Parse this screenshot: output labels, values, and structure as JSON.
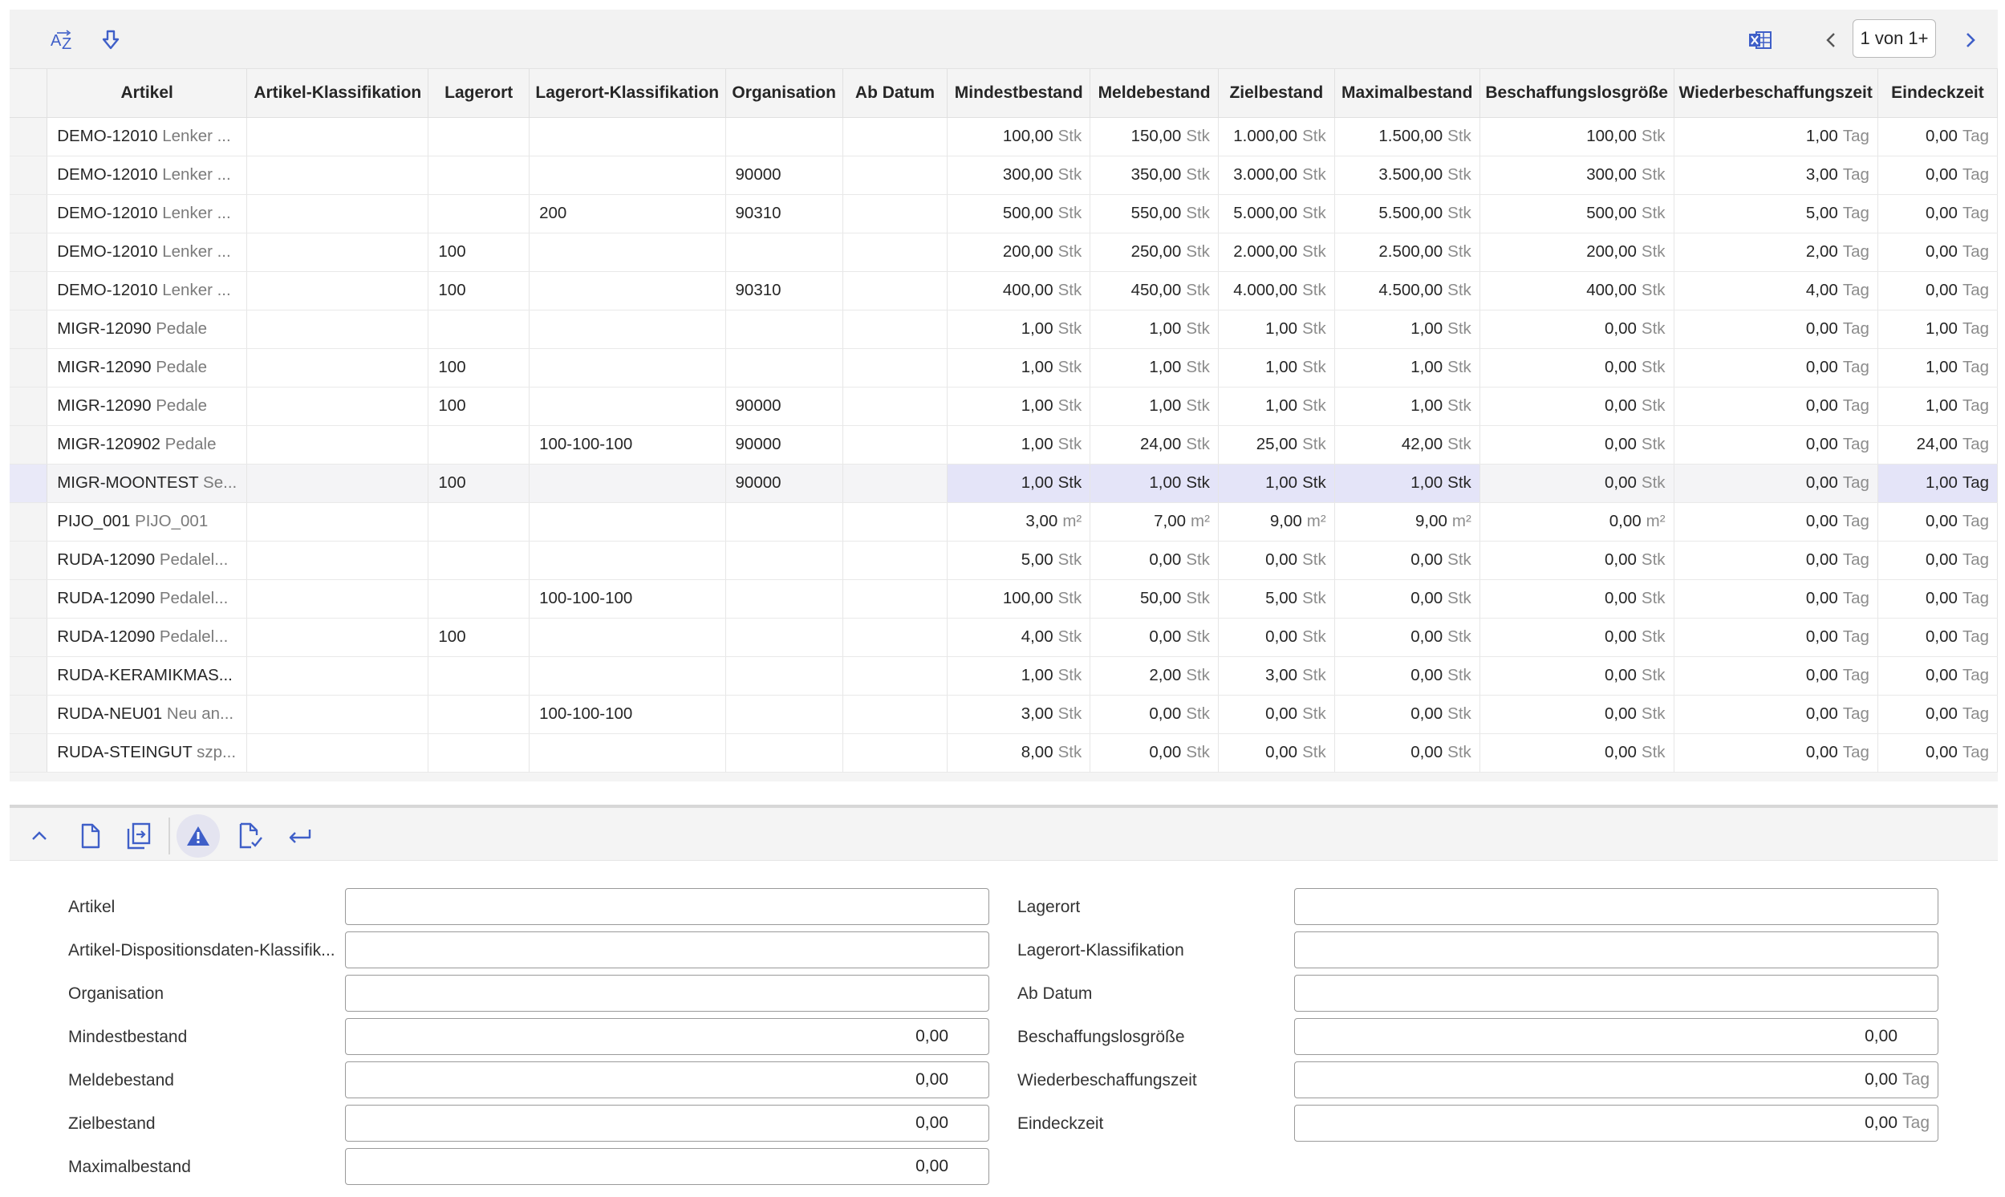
{
  "toolbar": {
    "sort_icon": "sort-az-icon",
    "download_icon": "arrow-down-icon",
    "excel_icon": "excel-icon",
    "pager_text": "1 von 1+"
  },
  "columns": [
    "Artikel",
    "Artikel-Klassifikation",
    "Lagerort",
    "Lagerort-Klassifikation",
    "Organisation",
    "Ab Datum",
    "Mindestbestand",
    "Meldebestand",
    "Zielbestand",
    "Maximalbestand",
    "Beschaffungslosgröße",
    "Wiederbeschaffungszeit",
    "Eindeckzeit"
  ],
  "rows": [
    {
      "code": "DEMO-12010",
      "desc": "Lenker ...",
      "lagerort": "",
      "lagerortkl": "",
      "org": "",
      "abdatum": "",
      "min": "100,00",
      "minu": "Stk",
      "meld": "150,00",
      "meldu": "Stk",
      "ziel": "1.000,00",
      "zielu": "Stk",
      "max": "1.500,00",
      "maxu": "Stk",
      "losg": "100,00",
      "losgu": "Stk",
      "wbz": "1,00",
      "wbzu": "Tag",
      "eind": "0,00",
      "eindu": "Tag"
    },
    {
      "code": "DEMO-12010",
      "desc": "Lenker ...",
      "lagerort": "",
      "lagerortkl": "",
      "org": "90000",
      "abdatum": "",
      "min": "300,00",
      "minu": "Stk",
      "meld": "350,00",
      "meldu": "Stk",
      "ziel": "3.000,00",
      "zielu": "Stk",
      "max": "3.500,00",
      "maxu": "Stk",
      "losg": "300,00",
      "losgu": "Stk",
      "wbz": "3,00",
      "wbzu": "Tag",
      "eind": "0,00",
      "eindu": "Tag"
    },
    {
      "code": "DEMO-12010",
      "desc": "Lenker ...",
      "lagerort": "",
      "lagerortkl": "200",
      "org": "90310",
      "abdatum": "",
      "min": "500,00",
      "minu": "Stk",
      "meld": "550,00",
      "meldu": "Stk",
      "ziel": "5.000,00",
      "zielu": "Stk",
      "max": "5.500,00",
      "maxu": "Stk",
      "losg": "500,00",
      "losgu": "Stk",
      "wbz": "5,00",
      "wbzu": "Tag",
      "eind": "0,00",
      "eindu": "Tag"
    },
    {
      "code": "DEMO-12010",
      "desc": "Lenker ...",
      "lagerort": "100",
      "lagerortkl": "",
      "org": "",
      "abdatum": "",
      "min": "200,00",
      "minu": "Stk",
      "meld": "250,00",
      "meldu": "Stk",
      "ziel": "2.000,00",
      "zielu": "Stk",
      "max": "2.500,00",
      "maxu": "Stk",
      "losg": "200,00",
      "losgu": "Stk",
      "wbz": "2,00",
      "wbzu": "Tag",
      "eind": "0,00",
      "eindu": "Tag"
    },
    {
      "code": "DEMO-12010",
      "desc": "Lenker ...",
      "lagerort": "100",
      "lagerortkl": "",
      "org": "90310",
      "abdatum": "",
      "min": "400,00",
      "minu": "Stk",
      "meld": "450,00",
      "meldu": "Stk",
      "ziel": "4.000,00",
      "zielu": "Stk",
      "max": "4.500,00",
      "maxu": "Stk",
      "losg": "400,00",
      "losgu": "Stk",
      "wbz": "4,00",
      "wbzu": "Tag",
      "eind": "0,00",
      "eindu": "Tag"
    },
    {
      "code": "MIGR-12090",
      "desc": "Pedale",
      "lagerort": "",
      "lagerortkl": "",
      "org": "",
      "abdatum": "",
      "min": "1,00",
      "minu": "Stk",
      "meld": "1,00",
      "meldu": "Stk",
      "ziel": "1,00",
      "zielu": "Stk",
      "max": "1,00",
      "maxu": "Stk",
      "losg": "0,00",
      "losgu": "Stk",
      "wbz": "0,00",
      "wbzu": "Tag",
      "eind": "1,00",
      "eindu": "Tag"
    },
    {
      "code": "MIGR-12090",
      "desc": "Pedale",
      "lagerort": "100",
      "lagerortkl": "",
      "org": "",
      "abdatum": "",
      "min": "1,00",
      "minu": "Stk",
      "meld": "1,00",
      "meldu": "Stk",
      "ziel": "1,00",
      "zielu": "Stk",
      "max": "1,00",
      "maxu": "Stk",
      "losg": "0,00",
      "losgu": "Stk",
      "wbz": "0,00",
      "wbzu": "Tag",
      "eind": "1,00",
      "eindu": "Tag"
    },
    {
      "code": "MIGR-12090",
      "desc": "Pedale",
      "lagerort": "100",
      "lagerortkl": "",
      "org": "90000",
      "abdatum": "",
      "min": "1,00",
      "minu": "Stk",
      "meld": "1,00",
      "meldu": "Stk",
      "ziel": "1,00",
      "zielu": "Stk",
      "max": "1,00",
      "maxu": "Stk",
      "losg": "0,00",
      "losgu": "Stk",
      "wbz": "0,00",
      "wbzu": "Tag",
      "eind": "1,00",
      "eindu": "Tag"
    },
    {
      "code": "MIGR-120902",
      "desc": "Pedale",
      "lagerort": "",
      "lagerortkl": "100-100-100",
      "org": "90000",
      "abdatum": "",
      "min": "1,00",
      "minu": "Stk",
      "meld": "24,00",
      "meldu": "Stk",
      "ziel": "25,00",
      "zielu": "Stk",
      "max": "42,00",
      "maxu": "Stk",
      "losg": "0,00",
      "losgu": "Stk",
      "wbz": "0,00",
      "wbzu": "Tag",
      "eind": "24,00",
      "eindu": "Tag"
    },
    {
      "code": "MIGR-MOONTEST",
      "desc": "Se...",
      "lagerort": "100",
      "lagerortkl": "",
      "org": "90000",
      "abdatum": "",
      "min": "1,00",
      "minu": "Stk",
      "meld": "1,00",
      "meldu": "Stk",
      "ziel": "1,00",
      "zielu": "Stk",
      "max": "1,00",
      "maxu": "Stk",
      "losg": "0,00",
      "losgu": "Stk",
      "wbz": "0,00",
      "wbzu": "Tag",
      "eind": "1,00",
      "eindu": "Tag",
      "active": true
    },
    {
      "code": "PIJO_001",
      "desc": "PIJO_001",
      "lagerort": "",
      "lagerortkl": "",
      "org": "",
      "abdatum": "",
      "min": "3,00",
      "minu": "m²",
      "meld": "7,00",
      "meldu": "m²",
      "ziel": "9,00",
      "zielu": "m²",
      "max": "9,00",
      "maxu": "m²",
      "losg": "0,00",
      "losgu": "m²",
      "wbz": "0,00",
      "wbzu": "Tag",
      "eind": "0,00",
      "eindu": "Tag"
    },
    {
      "code": "RUDA-12090",
      "desc": "Pedalel...",
      "lagerort": "",
      "lagerortkl": "",
      "org": "",
      "abdatum": "",
      "min": "5,00",
      "minu": "Stk",
      "meld": "0,00",
      "meldu": "Stk",
      "ziel": "0,00",
      "zielu": "Stk",
      "max": "0,00",
      "maxu": "Stk",
      "losg": "0,00",
      "losgu": "Stk",
      "wbz": "0,00",
      "wbzu": "Tag",
      "eind": "0,00",
      "eindu": "Tag"
    },
    {
      "code": "RUDA-12090",
      "desc": "Pedalel...",
      "lagerort": "",
      "lagerortkl": "100-100-100",
      "org": "",
      "abdatum": "",
      "min": "100,00",
      "minu": "Stk",
      "meld": "50,00",
      "meldu": "Stk",
      "ziel": "5,00",
      "zielu": "Stk",
      "max": "0,00",
      "maxu": "Stk",
      "losg": "0,00",
      "losgu": "Stk",
      "wbz": "0,00",
      "wbzu": "Tag",
      "eind": "0,00",
      "eindu": "Tag"
    },
    {
      "code": "RUDA-12090",
      "desc": "Pedalel...",
      "lagerort": "100",
      "lagerortkl": "",
      "org": "",
      "abdatum": "",
      "min": "4,00",
      "minu": "Stk",
      "meld": "0,00",
      "meldu": "Stk",
      "ziel": "0,00",
      "zielu": "Stk",
      "max": "0,00",
      "maxu": "Stk",
      "losg": "0,00",
      "losgu": "Stk",
      "wbz": "0,00",
      "wbzu": "Tag",
      "eind": "0,00",
      "eindu": "Tag"
    },
    {
      "code": "RUDA-KERAMIKMAS...",
      "desc": "",
      "lagerort": "",
      "lagerortkl": "",
      "org": "",
      "abdatum": "",
      "min": "1,00",
      "minu": "Stk",
      "meld": "2,00",
      "meldu": "Stk",
      "ziel": "3,00",
      "zielu": "Stk",
      "max": "0,00",
      "maxu": "Stk",
      "losg": "0,00",
      "losgu": "Stk",
      "wbz": "0,00",
      "wbzu": "Tag",
      "eind": "0,00",
      "eindu": "Tag"
    },
    {
      "code": "RUDA-NEU01",
      "desc": "Neu an...",
      "lagerort": "",
      "lagerortkl": "100-100-100",
      "org": "",
      "abdatum": "",
      "min": "3,00",
      "minu": "Stk",
      "meld": "0,00",
      "meldu": "Stk",
      "ziel": "0,00",
      "zielu": "Stk",
      "max": "0,00",
      "maxu": "Stk",
      "losg": "0,00",
      "losgu": "Stk",
      "wbz": "0,00",
      "wbzu": "Tag",
      "eind": "0,00",
      "eindu": "Tag"
    },
    {
      "code": "RUDA-STEINGUT",
      "desc": "szp...",
      "lagerort": "",
      "lagerortkl": "",
      "org": "",
      "abdatum": "",
      "min": "8,00",
      "minu": "Stk",
      "meld": "0,00",
      "meldu": "Stk",
      "ziel": "0,00",
      "zielu": "Stk",
      "max": "0,00",
      "maxu": "Stk",
      "losg": "0,00",
      "losgu": "Stk",
      "wbz": "0,00",
      "wbzu": "Tag",
      "eind": "0,00",
      "eindu": "Tag"
    }
  ],
  "detail_toolbar": {
    "icons": [
      "chevron-up-icon",
      "new-document-icon",
      "copy-document-icon",
      "warning-icon",
      "validate-document-icon",
      "return-icon"
    ]
  },
  "form": {
    "left": [
      {
        "label": "Artikel",
        "value": "",
        "unit": ""
      },
      {
        "label": "Artikel-Dispositionsdaten-Klassifik...",
        "value": "",
        "unit": ""
      },
      {
        "label": "Organisation",
        "value": "",
        "unit": ""
      },
      {
        "label": "Mindestbestand",
        "value": "0,00",
        "unit": ""
      },
      {
        "label": "Meldebestand",
        "value": "0,00",
        "unit": ""
      },
      {
        "label": "Zielbestand",
        "value": "0,00",
        "unit": ""
      },
      {
        "label": "Maximalbestand",
        "value": "0,00",
        "unit": ""
      }
    ],
    "right": [
      {
        "label": "Lagerort",
        "value": "",
        "unit": ""
      },
      {
        "label": "Lagerort-Klassifikation",
        "value": "",
        "unit": ""
      },
      {
        "label": "Ab Datum",
        "value": "",
        "unit": ""
      },
      {
        "label": "Beschaffungslosgröße",
        "value": "0,00",
        "unit": ""
      },
      {
        "label": "Wiederbeschaffungszeit",
        "value": "0,00",
        "unit": "Tag"
      },
      {
        "label": "Eindeckzeit",
        "value": "0,00",
        "unit": "Tag"
      }
    ]
  },
  "colors": {
    "accent": "#3f5fc8",
    "selected_row": "#e4e4f8"
  }
}
